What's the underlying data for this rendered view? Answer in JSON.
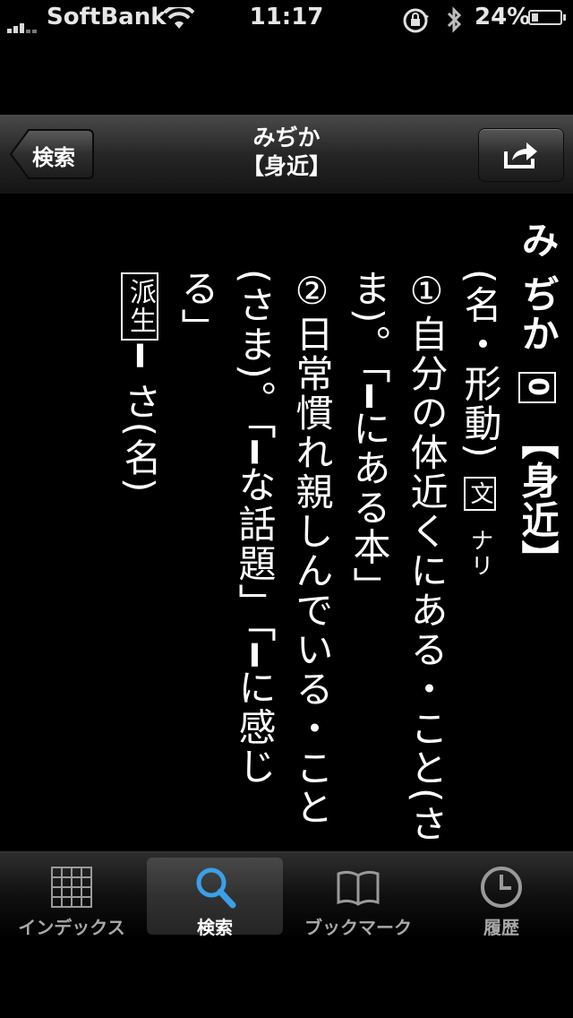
{
  "status": {
    "carrier": "SoftBank",
    "time": "11:17",
    "battery": "24%",
    "battery_level": 0.24,
    "icons": [
      "signal-icon",
      "wifi-icon",
      "rotation-lock-icon",
      "bluetooth-icon",
      "battery-icon"
    ]
  },
  "nav": {
    "back_label": "検索",
    "title": "みぢか",
    "subtitle": "【身近】",
    "share_icon": "share-icon"
  },
  "entry": {
    "reading": "み ぢか",
    "accent": "0",
    "kanji": "【身近】",
    "pos": "(名・形動)",
    "literary_mark": "文",
    "literary_form": "ナリ",
    "sense1_num": "①",
    "sense1_text": "自分の体近くにある・こと(さ",
    "sense1_cont": "ま)。「",
    "sense1_dash": "━",
    "sense1_example": "にある本」",
    "sense2_num": "②",
    "sense2_text": "日常慣れ親しんでいる・こと",
    "sense2_cont1": "(さま)。「",
    "sense2_dash1": "━",
    "sense2_example1": "な話題」「",
    "sense2_dash2": "━",
    "sense2_example2": "に感じ",
    "sense2_cont2": "る」",
    "derived_label": "派生",
    "derived_dash": "━",
    "derived_text": " さ(名)"
  },
  "tabs": [
    {
      "label": "インデックス",
      "icon": "grid-icon",
      "selected": false
    },
    {
      "label": "検索",
      "icon": "search-icon",
      "selected": true
    },
    {
      "label": "ブックマーク",
      "icon": "book-icon",
      "selected": false
    },
    {
      "label": "履歴",
      "icon": "clock-icon",
      "selected": false
    }
  ],
  "colors": {
    "background": "#000000",
    "accent_blue": "#3aa0e8",
    "tab_inactive": "#a8a8a8"
  }
}
